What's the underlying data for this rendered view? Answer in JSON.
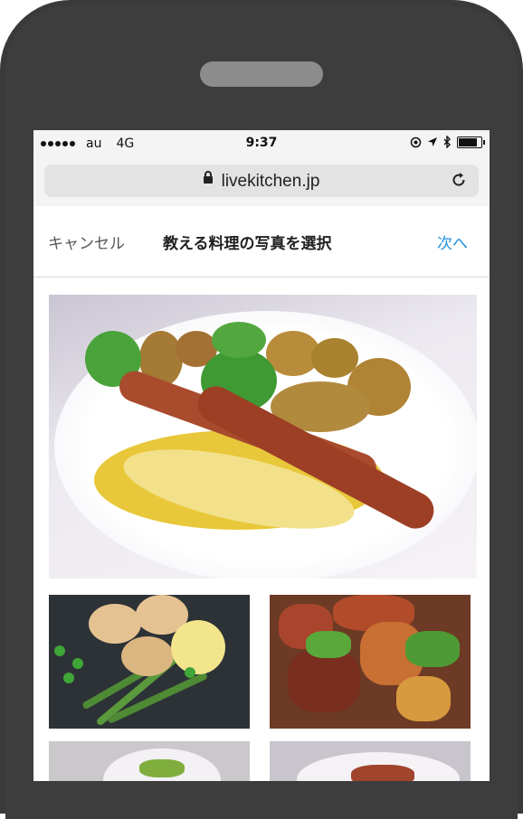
{
  "status_bar": {
    "carrier": "au",
    "network": "4G",
    "time": "9:37"
  },
  "browser": {
    "url": "livekitchen.jp"
  },
  "nav": {
    "cancel": "キャンセル",
    "title": "教える料理の写真を選択",
    "next": "次へ"
  },
  "colors": {
    "accent": "#1e8fdc",
    "frame": "#3a3a3a"
  },
  "icons": [
    "signal-dots-icon",
    "location-icon",
    "navigation-arrow-icon",
    "bluetooth-icon",
    "battery-icon",
    "lock-icon",
    "reload-icon"
  ]
}
